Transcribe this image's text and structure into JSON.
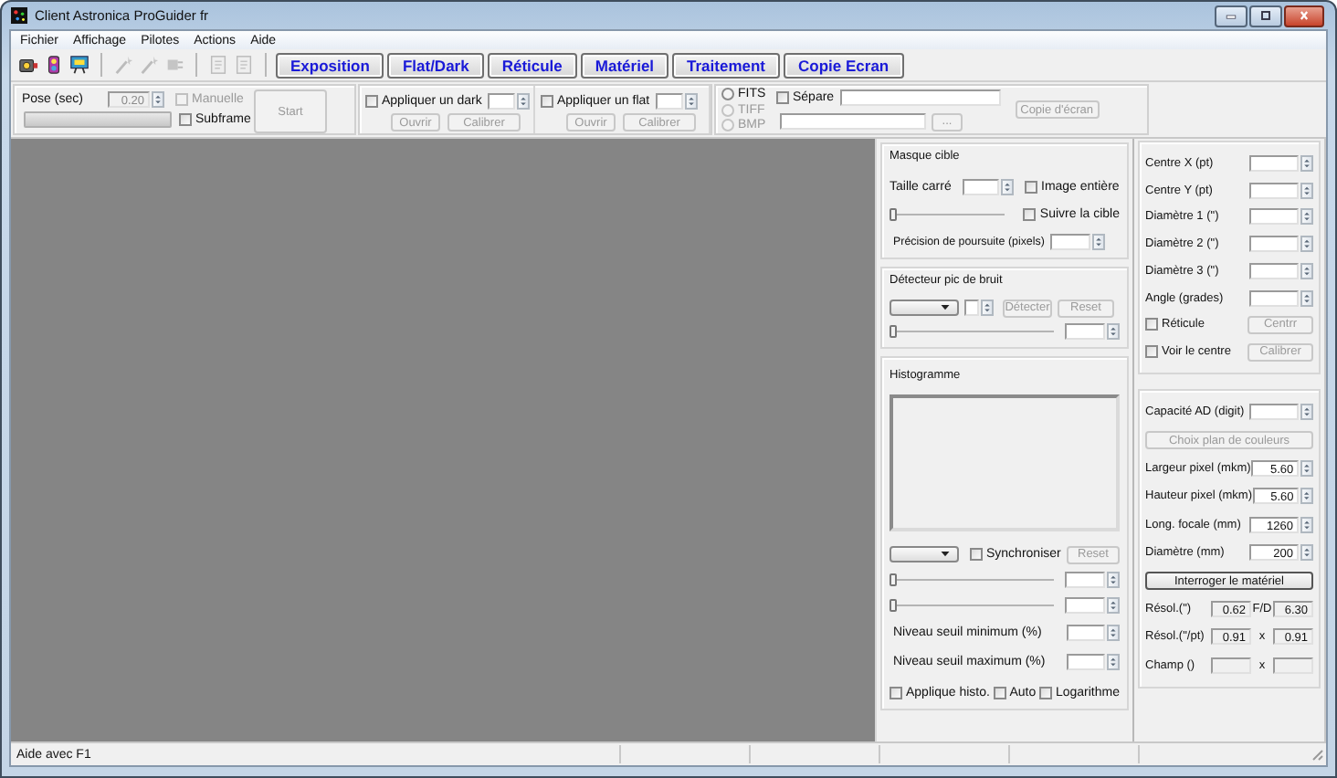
{
  "window": {
    "title": "Client Astronica ProGuider fr"
  },
  "menu": [
    "Fichier",
    "Affichage",
    "Pilotes",
    "Actions",
    "Aide"
  ],
  "toolbar": [
    [
      {
        "kind": "camera",
        "disabled": false
      },
      {
        "kind": "wheel",
        "disabled": false
      },
      {
        "kind": "scope",
        "disabled": false
      }
    ],
    [
      {
        "kind": "wand",
        "disabled": true
      },
      {
        "kind": "wand",
        "disabled": true
      },
      {
        "kind": "plug",
        "disabled": true
      }
    ],
    [
      {
        "kind": "page",
        "disabled": true
      },
      {
        "kind": "page",
        "disabled": true
      }
    ]
  ],
  "tabs": [
    {
      "label": "Exposition",
      "selected": false
    },
    {
      "label": "Flat/Dark",
      "selected": false
    },
    {
      "label": "Réticule",
      "selected": false
    },
    {
      "label": "Matériel",
      "selected": false
    },
    {
      "label": "Traitement",
      "selected": false
    },
    {
      "label": "Copie Ecran",
      "selected": false
    }
  ],
  "exposure": {
    "label": "Pose (sec)",
    "field": {
      "value": "0.20",
      "disabled": true
    },
    "progress": {
      "level": 0
    },
    "checks": [
      {
        "label": "Manuelle",
        "checked": false,
        "disabled": true
      },
      {
        "label": "Subframe",
        "checked": false,
        "disabled": false
      }
    ],
    "start": {
      "label": "Start",
      "disabled": true
    }
  },
  "calibration": [
    {
      "check": {
        "label": "Appliquer un dark",
        "checked": false,
        "disabled": false
      },
      "buttons": [
        {
          "label": "Ouvrir",
          "disabled": true
        },
        {
          "label": "Calibrer",
          "disabled": true
        }
      ]
    },
    {
      "check": {
        "label": "Appliquer un flat",
        "checked": false,
        "disabled": false
      },
      "buttons": [
        {
          "label": "Ouvrir",
          "disabled": true
        },
        {
          "label": "Calibrer",
          "disabled": true
        }
      ]
    }
  ],
  "capture": {
    "formats": [
      {
        "label": "FITS",
        "selected": false,
        "disabled": false
      },
      {
        "label": "TIFF",
        "selected": false,
        "disabled": true
      },
      {
        "label": "BMP",
        "selected": false,
        "disabled": true
      }
    ],
    "separate": {
      "label": "Sépare",
      "checked": false,
      "disabled": false
    },
    "browse": {
      "label": "...",
      "disabled": true
    },
    "button": {
      "label": "Copie d'écran",
      "disabled": true
    }
  },
  "target_mask": {
    "title": "Masque cible",
    "size_label": "Taille carré",
    "checks": [
      {
        "label": "Image entière",
        "checked": false,
        "disabled": false
      },
      {
        "label": "Suivre la cible",
        "checked": false,
        "disabled": false
      }
    ],
    "slider": {
      "level": 0
    },
    "precision_label": "Précision de poursuite (pixels)"
  },
  "noise": {
    "title": "Détecteur pic de bruit",
    "buttons": [
      {
        "label": "Détecter",
        "disabled": true
      },
      {
        "label": "Reset",
        "disabled": true
      }
    ],
    "slider": {
      "level": 0
    }
  },
  "histogram": {
    "title": "Histogramme",
    "sync": {
      "label": "Synchroniser",
      "checked": false,
      "disabled": false
    },
    "reset": {
      "label": "Reset",
      "disabled": true
    },
    "sliders": [
      {
        "level": 0
      },
      {
        "level": 0
      }
    ],
    "thresholds": [
      "Niveau seuil minimum (%)",
      "Niveau seuil maximum (%)"
    ],
    "checks": [
      {
        "label": "Applique histo.",
        "checked": false,
        "disabled": false
      },
      {
        "label": "Auto",
        "checked": false,
        "disabled": false
      },
      {
        "label": "Logarithme",
        "checked": false,
        "disabled": false
      }
    ]
  },
  "reticle": {
    "fields": [
      "Centre X (pt)",
      "Centre Y (pt)",
      "Diamètre 1 (\")",
      "Diamètre 2 (\")",
      "Diamètre 3 (\")",
      "Angle (grades)"
    ],
    "options": [
      {
        "label": "Réticule",
        "checked": false,
        "disabled": false,
        "button": {
          "label": "Centrr",
          "disabled": true
        }
      },
      {
        "label": "Voir le centre",
        "checked": false,
        "disabled": false,
        "button": {
          "label": "Calibrer",
          "disabled": true
        }
      }
    ]
  },
  "hardware": {
    "ad_label": "Capacité AD (digit)",
    "color_button": {
      "label": "Choix plan de couleurs",
      "disabled": true
    },
    "fields": [
      {
        "label": "Largeur pixel (mkm)",
        "value": "5.60"
      },
      {
        "label": "Hauteur pixel (mkm)",
        "value": "5.60"
      },
      {
        "label": "Long. focale (mm)",
        "value": "1260"
      },
      {
        "label": "Diamètre (mm)",
        "value": "200"
      }
    ],
    "query": {
      "label": "Interroger le matériel",
      "disabled": false
    },
    "results": [
      {
        "label": "Résol.(\")",
        "value": "0.62",
        "sep": "F/D",
        "value2": "6.30"
      },
      {
        "label": "Résol.(\"/pt)",
        "value": "0.91",
        "sep": "x",
        "value2": "0.91"
      },
      {
        "label": "Champ ()",
        "sep": "x"
      }
    ]
  },
  "status_bar": {
    "text": "Aide avec F1"
  }
}
